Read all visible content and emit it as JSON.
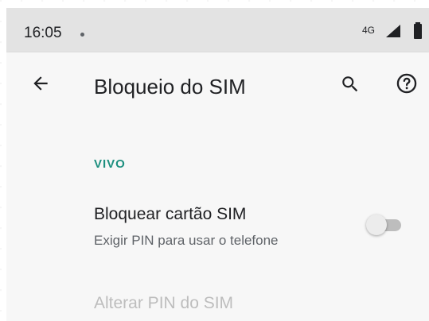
{
  "status_bar": {
    "time": "16:05",
    "network": "4G",
    "icons": [
      "notification-dot-icon",
      "signal-icon",
      "battery-icon"
    ]
  },
  "app_bar": {
    "title": "Bloqueio do SIM",
    "icons": [
      "back-arrow-icon",
      "search-icon",
      "help-icon"
    ]
  },
  "content": {
    "section": "VIVO",
    "sim_lock": {
      "title": "Bloquear cartão SIM",
      "subtitle": "Exigir PIN para usar o telefone",
      "enabled": false
    },
    "change_pin": {
      "title": "Alterar PIN do SIM"
    }
  },
  "colors": {
    "accent": "#1d8f7f",
    "disabled_text": "#bdbdbd",
    "toggle_track_off": "#bdbdbd",
    "toggle_thumb_off": "#ececec"
  }
}
